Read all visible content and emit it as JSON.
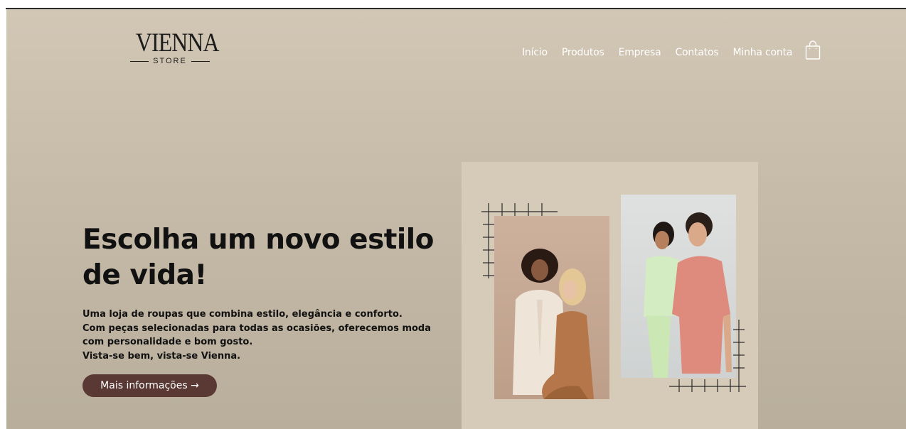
{
  "brand": {
    "name": "VIENNA",
    "tagline": "STORE"
  },
  "nav": {
    "items": [
      {
        "label": "Início"
      },
      {
        "label": "Produtos"
      },
      {
        "label": "Empresa"
      },
      {
        "label": "Contatos"
      },
      {
        "label": "Minha conta"
      }
    ],
    "cart_icon": "shopping-bag-icon"
  },
  "hero": {
    "title": "Escolha um novo estilo de vida!",
    "description": [
      "Uma loja de roupas que combina estilo, elegância e conforto.",
      "Com peças selecionadas para todas as ocasiões, oferecemos moda com personalidade e bom gosto.",
      "Vista-se bem, vista-se Vienna."
    ],
    "cta_label": "Mais informações →"
  },
  "colors": {
    "background_top": "#d2c6b5",
    "background_bottom": "#b9ae9c",
    "panel": "#d6cab9",
    "button": "#5a3834",
    "nav_text": "#ffffff",
    "heading": "#111111"
  }
}
